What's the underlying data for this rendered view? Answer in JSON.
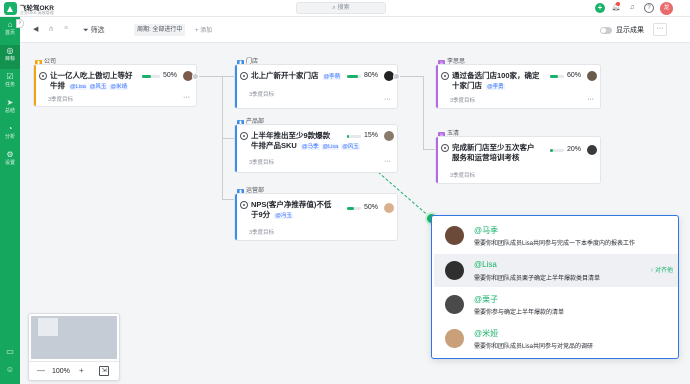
{
  "app": {
    "brand": "飞轮驾OKR",
    "brand_sub": "企业OKR 高效管理",
    "search_placeholder": "搜索",
    "avatar_text": "龙"
  },
  "sidebar": {
    "items": [
      {
        "icon": "⌂",
        "label": "首页"
      },
      {
        "icon": "◎",
        "label": "目标"
      },
      {
        "icon": "☑",
        "label": "任务"
      },
      {
        "icon": "➤",
        "label": "总结"
      },
      {
        "icon": "◔",
        "label": "分析"
      },
      {
        "icon": "⚙",
        "label": "设置"
      }
    ],
    "bottom_icons": [
      "book-icon",
      "person-icon"
    ]
  },
  "toolbar": {
    "filter_label": "筛选",
    "period_label": "周期: 全部进行中",
    "add_label": "+ 添加",
    "show_results_label": "显示成果",
    "more_label": "···"
  },
  "groups": [
    {
      "label": "公司",
      "color": "#f2a30f"
    },
    {
      "label": "门店",
      "color": "#3b8fe8"
    },
    {
      "label": "产品部",
      "color": "#3b8fe8"
    },
    {
      "label": "运营部",
      "color": "#3b8fe8"
    },
    {
      "label": "李思思",
      "color": "#b269e6"
    },
    {
      "label": "玉清",
      "color": "#b269e6"
    }
  ],
  "cards": [
    {
      "title_line1": "让一亿人吃上傲切上等好",
      "title_line2": "牛排",
      "people": [
        "@Lisa",
        "@风玉",
        "@米靖"
      ],
      "percent": 50,
      "pct_label": "50%",
      "cycle": "3季度目标",
      "bar_color": "#f2a30f"
    },
    {
      "title_line1": "北上广新开十家门店",
      "title_line2": "",
      "people": [
        "@李萌"
      ],
      "percent": 80,
      "pct_label": "80%",
      "cycle": "3季度目标",
      "bar_color": "#3b8fe8"
    },
    {
      "title_line1": "上半年推出至少9款爆款",
      "title_line2": "牛排产品SKU",
      "people": [
        "@马季",
        "@Lisa",
        "@风玉"
      ],
      "percent": 15,
      "pct_label": "15%",
      "cycle": "3季度目标",
      "bar_color": "#3b8fe8"
    },
    {
      "title_line1": "NPS(客户净推荐值)不低",
      "title_line2": "于9分",
      "people": [
        "@冯玉"
      ],
      "percent": 50,
      "pct_label": "50%",
      "cycle": "3季度目标",
      "bar_color": "#3b8fe8"
    },
    {
      "title_line1": "通过备选门店100家，确定",
      "title_line2": "十家门店",
      "people": [
        "@李勇"
      ],
      "percent": 60,
      "pct_label": "60%",
      "cycle": "3季度目标",
      "bar_color": "#b269e6"
    },
    {
      "title_line1": "完成新门店至少五次客户",
      "title_line2": "服务和运营培训考核",
      "people": [],
      "percent": 20,
      "pct_label": "20%",
      "cycle": "3季度目标",
      "bar_color": "#b269e6"
    }
  ],
  "minimap": {
    "zoom_label": "100%",
    "minus": "—",
    "plus": "+"
  },
  "mention_popup": {
    "items": [
      {
        "name": "@马季",
        "desc": "需要你和团队成员Lisa共同参与完成一下本季度内的报表工作",
        "action": "",
        "avatar_color": "#6b4a3a"
      },
      {
        "name": "@Lisa",
        "desc": "需要你和团队成员栗子确定上半年爆款类目清单",
        "action": "↑ 对齐他",
        "avatar_color": "#2f2f2f"
      },
      {
        "name": "@栗子",
        "desc": "需要你参与确定上半年爆款的清单",
        "action": "",
        "avatar_color": "#4a4a4a"
      },
      {
        "name": "@米娅",
        "desc": "需要你和团队成员Lisa共同参与对竞品的调研",
        "action": "",
        "avatar_color": "#c9a07a"
      }
    ]
  }
}
